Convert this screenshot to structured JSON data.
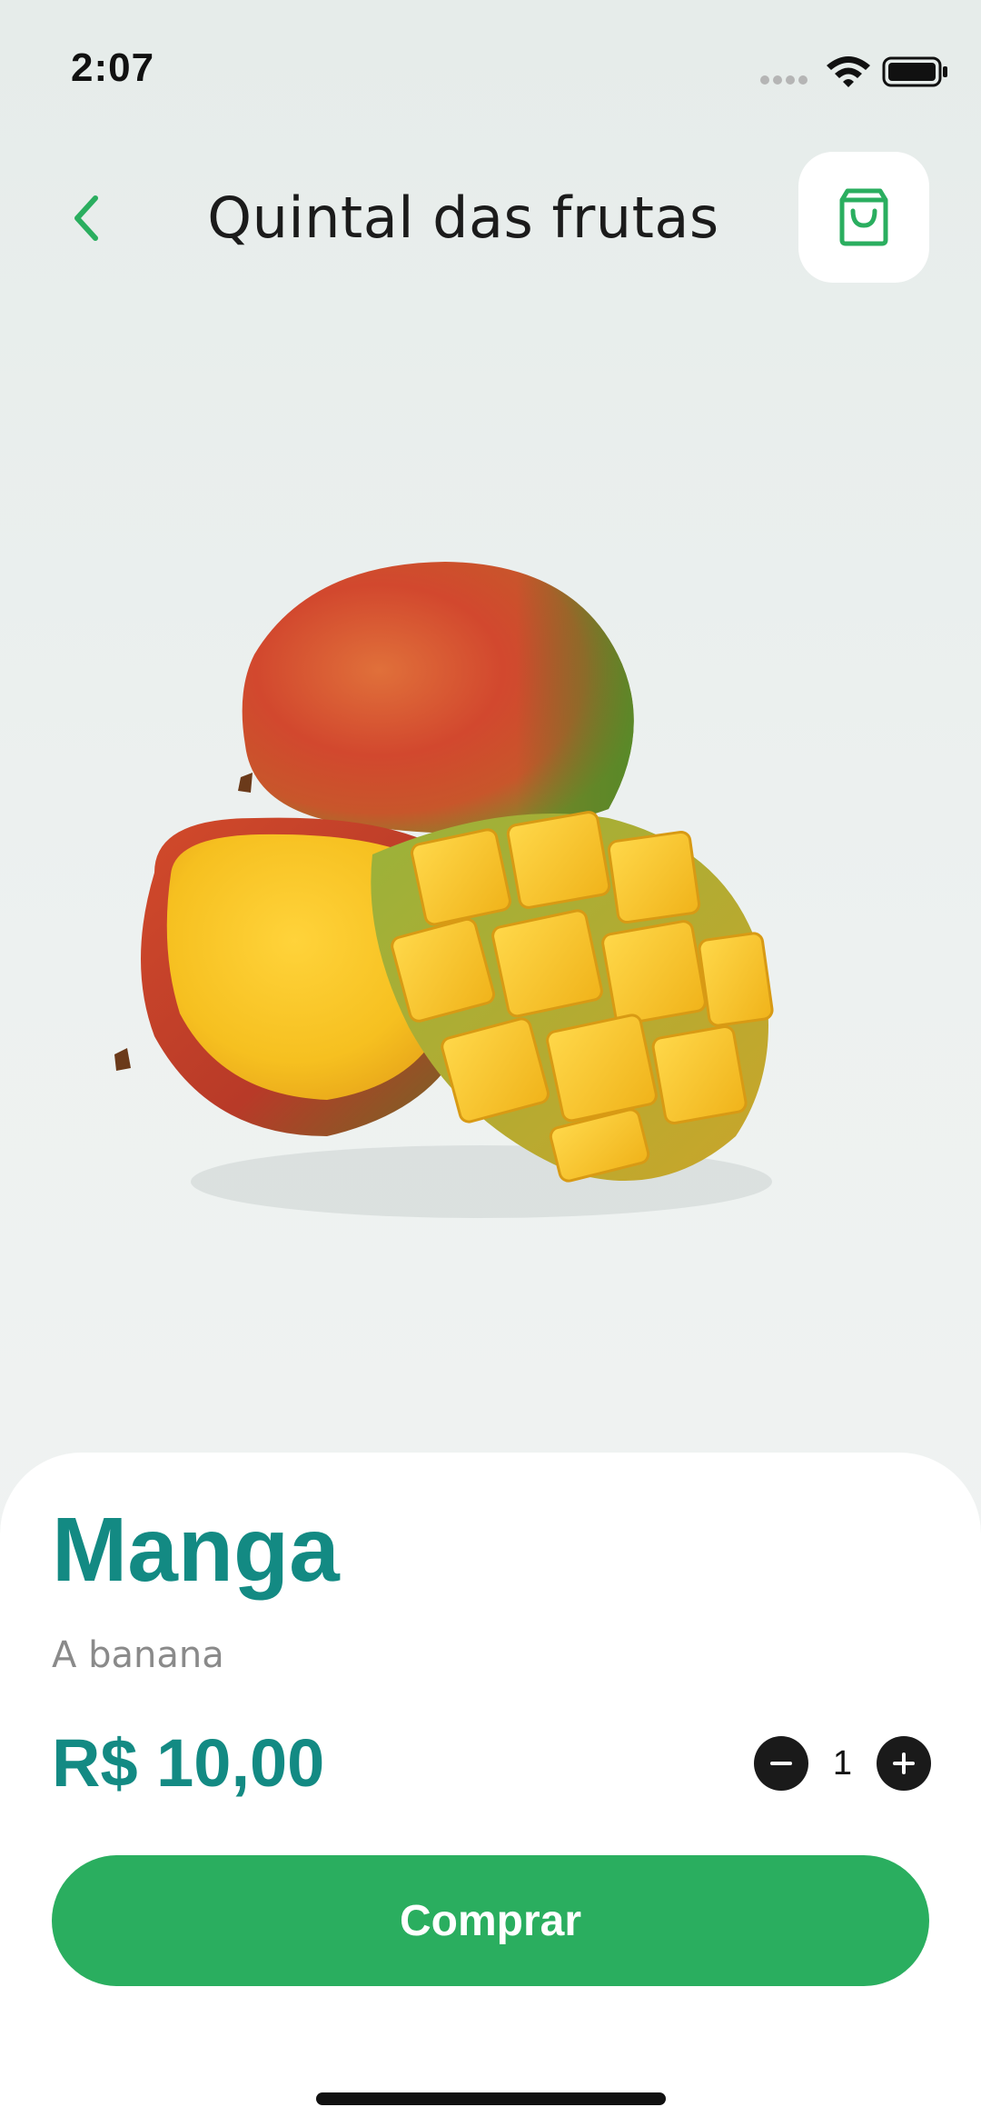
{
  "status_bar": {
    "time": "2:07",
    "icons": [
      "signal-icon",
      "wifi-icon",
      "battery-icon"
    ]
  },
  "header": {
    "back_icon": "chevron-left-icon",
    "title": "Quintal das frutas",
    "cart_icon": "shopping-bag-icon"
  },
  "product": {
    "image": "mango-image",
    "name": "Manga",
    "description": "A banana",
    "price": "R$ 10,00",
    "quantity": "1"
  },
  "actions": {
    "buy_label": "Comprar",
    "minus_icon": "minus-icon",
    "plus_icon": "plus-icon"
  },
  "colors": {
    "accent_green": "#2aae5f",
    "teal_text": "#138a83"
  }
}
